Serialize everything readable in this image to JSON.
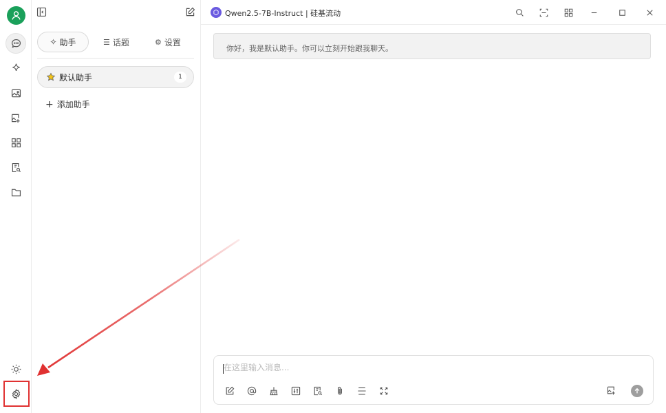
{
  "window": {
    "title": "Qwen2.5-7B-Instruct | 硅基流动"
  },
  "rail": {
    "items": [
      {
        "icon": "chat-icon",
        "active": true
      },
      {
        "icon": "sparkle-icon"
      },
      {
        "icon": "image-icon"
      },
      {
        "icon": "image-edit-icon"
      },
      {
        "icon": "apps-grid-icon"
      },
      {
        "icon": "document-search-icon"
      },
      {
        "icon": "folder-icon"
      }
    ],
    "bottom": [
      {
        "icon": "sun-icon"
      },
      {
        "icon": "gear-icon",
        "highlighted": true
      }
    ]
  },
  "panel": {
    "tabs": [
      {
        "label": "助手",
        "icon": "sparkle-icon",
        "active": true
      },
      {
        "label": "话题",
        "icon": "list-icon"
      },
      {
        "label": "设置",
        "icon": "gear-icon"
      }
    ],
    "assistants": [
      {
        "label": "默认助手",
        "icon": "star-icon",
        "count": "1"
      }
    ],
    "add_label": "添加助手"
  },
  "chat": {
    "greeting": "你好，我是默认助手。你可以立刻开始跟我聊天。",
    "input_placeholder": "在这里输入消息...",
    "input_value": ""
  },
  "colors": {
    "avatar": "#1aa05a",
    "highlight": "#e03131",
    "model_logo": "#6a5ae0"
  }
}
